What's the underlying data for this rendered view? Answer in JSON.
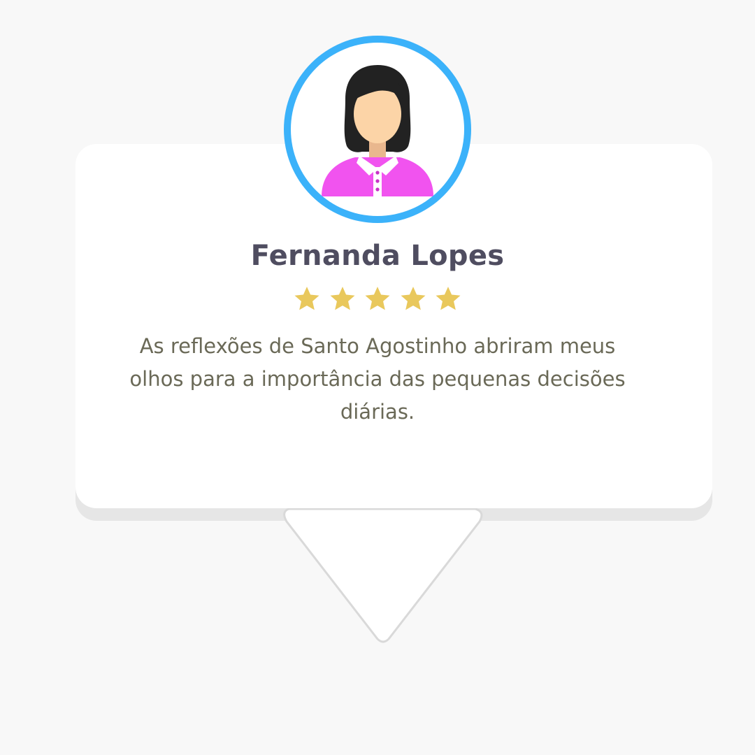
{
  "testimonial": {
    "name": "Fernanda Lopes",
    "rating": 5,
    "rating_max": 5,
    "review": "As reflexões de Santo Agostinho abriram meus olhos para a importância das pequenas decisões diárias."
  },
  "colors": {
    "background": "#f8f8f8",
    "card": "#ffffff",
    "card_shadow": "#e6e6e6",
    "avatar_ring": "#3bb2fa",
    "name_text": "#4f4d60",
    "review_text": "#6a6957",
    "star": "#e9c85c",
    "shirt": "#f153ef",
    "hair": "#222222",
    "skin": "#fcd4a7"
  },
  "icons": {
    "avatar": "woman-avatar-icon",
    "star": "star-icon"
  }
}
